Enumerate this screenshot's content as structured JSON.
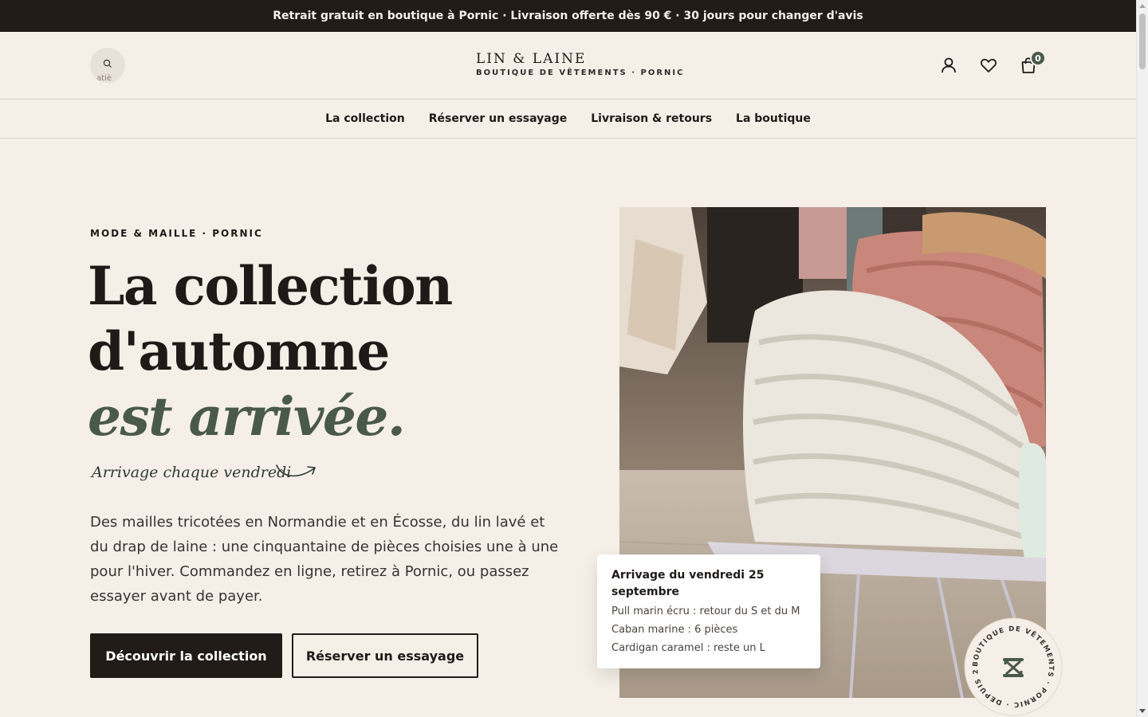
{
  "announcement": "Retrait gratuit en boutique à Pornic · Livraison offerte dès 90 € · 30 jours pour changer d'avis",
  "header": {
    "search_placeholder": "atiè",
    "logo_name": "LIN & LAINE",
    "logo_subtitle": "BOUTIQUE DE VÊTEMENTS · PORNIC",
    "cart_count": "0"
  },
  "nav": {
    "items": [
      "La collection",
      "Réserver un essayage",
      "Livraison & retours",
      "La boutique"
    ]
  },
  "hero": {
    "eyebrow": "MODE & MAILLE · PORNIC",
    "title_line1": "La collection",
    "title_line2": "d'automne",
    "title_accent": "est arrivée.",
    "script_note": "Arrivage chaque vendredi",
    "description": "Des mailles tricotées en Normandie et en Écosse, du lin lavé et du drap de laine : une cinquantaine de pièces choisies une à une pour l'hiver. Commandez en ligne, retirez à Pornic, ou passez essayer avant de payer.",
    "primary_cta": "Découvrir la collection",
    "secondary_cta": "Réserver un essayage"
  },
  "arrival_card": {
    "title": "Arrivage du vendredi 25 septembre",
    "lines": [
      "Pull marin écru : retour du S et du M",
      "Caban marine : 6 pièces",
      "Cardigan caramel : reste un L"
    ]
  },
  "badge": {
    "ring_text": "BOUTIQUE DE VÊTEMENTS · PORNIC · DEPUIS 2014"
  },
  "colors": {
    "background": "#f5efe8",
    "dark": "#221c18",
    "accent_green": "#4a5a4a"
  }
}
